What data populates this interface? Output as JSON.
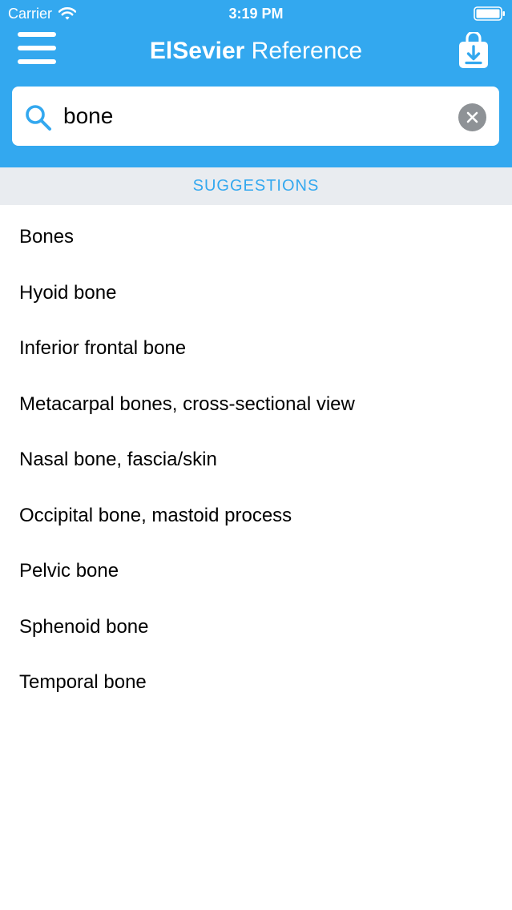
{
  "status_bar": {
    "carrier": "Carrier",
    "time": "3:19 PM",
    "icons": [
      "wifi-icon",
      "battery-icon"
    ]
  },
  "header": {
    "title_brand": "ElSevier",
    "title_rest": " Reference",
    "menu_icon": "hamburger-menu-icon",
    "download_icon": "download-bag-icon",
    "background_color": "#33a8ef"
  },
  "search": {
    "value": "bone",
    "icon": "search-icon",
    "clear_icon": "clear-icon"
  },
  "suggestions": {
    "header": "SUGGESTIONS",
    "items": [
      "Bones",
      "Hyoid bone",
      "Inferior frontal bone",
      "Metacarpal bones, cross-sectional view",
      "Nasal bone, fascia/skin",
      "Occipital bone, mastoid process",
      "Pelvic bone",
      "Sphenoid bone",
      "Temporal bone"
    ]
  }
}
